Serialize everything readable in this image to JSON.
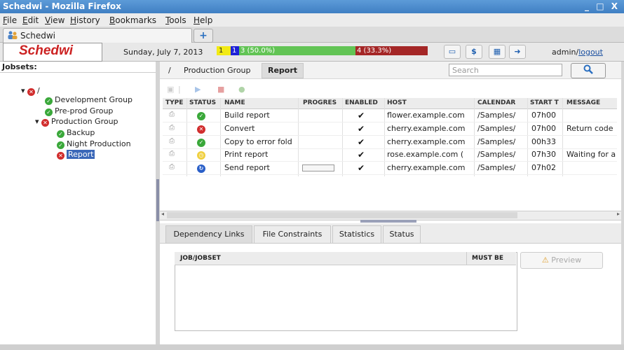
{
  "window": {
    "title": "Schedwi - Mozilla Firefox",
    "controls": "_ □ X"
  },
  "menu": [
    "File",
    "Edit",
    "View",
    "History",
    "Bookmarks",
    "Tools",
    "Help"
  ],
  "browser_tab": {
    "label": "Schedwi",
    "new_tab": "+"
  },
  "app": {
    "logo": "Schedwi",
    "date": "Sunday, July 7, 2013",
    "status_bar": {
      "seg1": "1",
      "seg2": "1",
      "seg3": "3 (50.0%)",
      "seg4": "4 (33.3%)",
      "colors": {
        "yellow": "#f2ea14",
        "blue": "#1e22d8",
        "green": "#62c455",
        "red": "#a42626"
      }
    },
    "header_icons": [
      "monitor-icon",
      "dollar-icon",
      "calendar-icon",
      "exit-icon"
    ],
    "user": "admin/",
    "logout": "logout"
  },
  "left": {
    "header": "Jobsets:",
    "root": "/",
    "tree": [
      "Development Group",
      "Pre-prod Group",
      "Production Group",
      "Backup",
      "Night Production",
      "Report"
    ]
  },
  "breadcrumb": {
    "root": "/",
    "group": "Production Group",
    "current": "Report"
  },
  "search": {
    "placeholder": "Search"
  },
  "table": {
    "headers": [
      "TYPE",
      "STATUS",
      "NAME",
      "PROGRES",
      "ENABLED",
      "HOST",
      "CALENDAR",
      "START T",
      "MESSAGE"
    ],
    "rows": [
      {
        "status": "ok",
        "name": "Build report",
        "enabled": "✔",
        "host": "flower.example.com",
        "calendar": "/Samples/",
        "start": "07h00",
        "message": ""
      },
      {
        "status": "error",
        "name": "Convert",
        "enabled": "✔",
        "host": "cherry.example.com",
        "calendar": "/Samples/",
        "start": "07h00",
        "message": "Return code"
      },
      {
        "status": "ok",
        "name": "Copy to error fold",
        "enabled": "✔",
        "host": "cherry.example.com",
        "calendar": "/Samples/",
        "start": "00h33",
        "message": ""
      },
      {
        "status": "waiting",
        "name": "Print report",
        "enabled": "✔",
        "host": "rose.example.com (",
        "calendar": "/Samples/",
        "start": "07h30",
        "message": "Waiting for a"
      },
      {
        "status": "running",
        "name": "Send report",
        "enabled": "✔",
        "host": "cherry.example.com",
        "calendar": "/Samples/",
        "start": "07h02",
        "message": ""
      }
    ]
  },
  "bottom_tabs": [
    "Dependency Links",
    "File Constraints",
    "Statistics",
    "Status"
  ],
  "dependency": {
    "col1": "JOB/JOBSET",
    "col2": "MUST BE",
    "preview": "Preview"
  }
}
